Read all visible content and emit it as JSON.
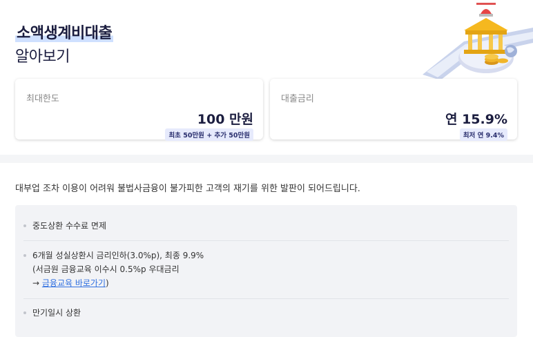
{
  "header": {
    "title_line1": "소액생계비대출",
    "title_line2": "알아보기"
  },
  "cards": [
    {
      "label": "최대한도",
      "value": "100 만원",
      "badge": "최초 50만원 + 추가 50만원"
    },
    {
      "label": "대출금리",
      "value": "연 15.9%",
      "badge": "최저 연 9.4%"
    }
  ],
  "description": "대부업 조차 이용이 어려워 불법사금융이 불가피한 고객의 재기를 위한 발판이 되어드립니다.",
  "benefits": {
    "item1": "중도상환 수수료 면제",
    "item2_line1": "6개월 성실상환시 금리인하(3.0%p), 최종 9.9%",
    "item2_line2": "(서금원 금융교육 이수시 0.5%p 우대금리",
    "item2_arrow": "→ ",
    "item2_link": "금융교육 바로가기",
    "item2_close": ")",
    "item3": "만기일시 상환"
  },
  "colors": {
    "title": "#1b1d3f",
    "highlight": "#cfe0ff",
    "badge_bg": "#e6eafc",
    "link": "#2f6fe0"
  },
  "icons": [
    "bank-coin-illustration"
  ]
}
